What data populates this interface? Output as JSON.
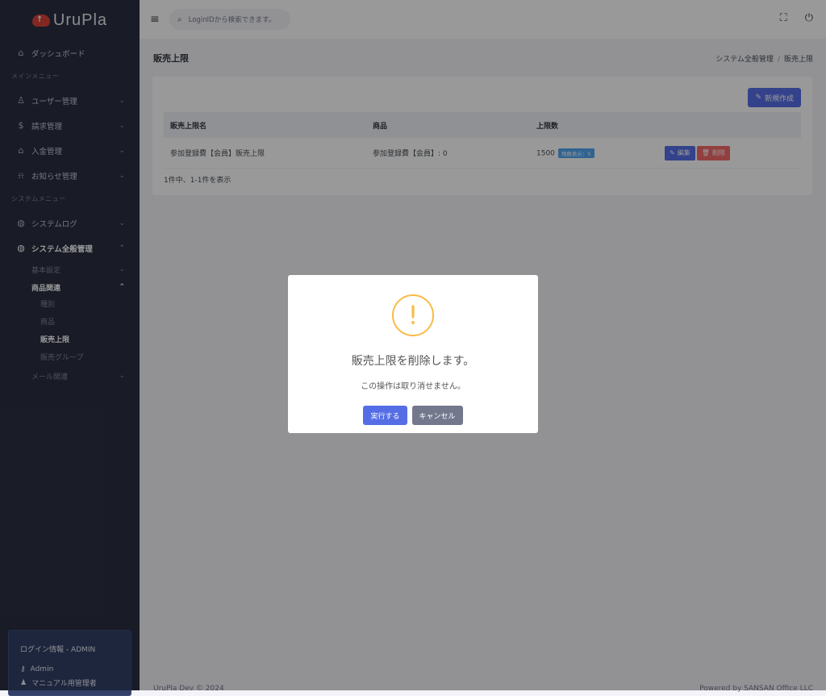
{
  "app": {
    "logo_text": "UruPla",
    "logo_glyph": "↑"
  },
  "topbar": {
    "search_placeholder": "LoginIDから検索できます。",
    "menu_icon": "hamburger-icon",
    "fullscreen_icon": "fullscreen-icon",
    "power_icon": "power-icon"
  },
  "sidebar": {
    "dashboard": "ダッシュボード",
    "main_menu_title": "メインメニュー",
    "main_items": [
      "ユーザー管理",
      "請求管理",
      "入金管理",
      "お知らせ管理"
    ],
    "system_menu_title": "システムメニュー",
    "system_log": "システムログ",
    "system_general": "システム全般管理",
    "basic_settings": "基本設定",
    "product_related": "商品関連",
    "product_sub": [
      "種別",
      "商品",
      "販売上限",
      "販売グループ"
    ],
    "mail_related": "メール関連"
  },
  "login_box": {
    "title": "ログイン情報 - ADMIN",
    "user_id": "Admin",
    "role": "マニュアル用管理者"
  },
  "page": {
    "title": "販売上限",
    "breadcrumb": [
      "システム全般管理",
      "販売上限"
    ]
  },
  "card": {
    "new_button": "新規作成",
    "columns": [
      "販売上限名",
      "商品",
      "上限数",
      ""
    ],
    "rows": [
      {
        "name": "参加登録費【会員】販売上限",
        "product": "参加登録費【会員】: 0",
        "limit": "1500",
        "badge": "残数表示：5",
        "edit": "編集",
        "delete": "削除"
      }
    ],
    "count_text": "1件中、1-1件を表示"
  },
  "footer": {
    "left": "UruPla Dev © 2024",
    "right": "Powered by SANSAN Office LLC"
  },
  "modal": {
    "icon": "!",
    "title": "販売上限を削除します。",
    "text": "この操作は取り消せません。",
    "confirm": "実行する",
    "cancel": "キャンセル"
  },
  "colors": {
    "primary": "#556ee6",
    "danger": "#f46a6a",
    "warning": "#f8bb47",
    "sidebar": "#2b3041",
    "secondary": "#74788d"
  }
}
